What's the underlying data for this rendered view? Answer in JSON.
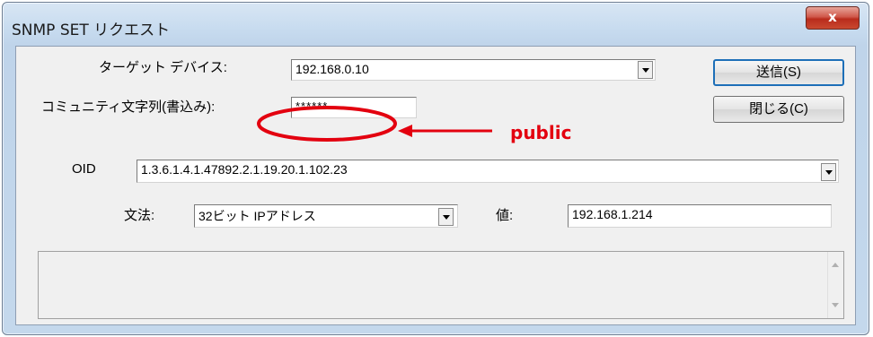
{
  "window": {
    "title": "SNMP SET リクエスト",
    "close_glyph": "x"
  },
  "target": {
    "label": "ターゲット デバイス:",
    "value": "192.168.0.10"
  },
  "community": {
    "label": "コミュニティ文字列(書込み):",
    "value": "******"
  },
  "buttons": {
    "send": "送信(S)",
    "close": "閉じる(C)"
  },
  "oid": {
    "label": "OID",
    "value": "1.3.6.1.4.1.47892.2.1.19.20.1.102.23"
  },
  "syntax": {
    "label": "文法:",
    "value": "32ビット IPアドレス"
  },
  "val": {
    "label": "値:",
    "value": "192.168.1.214"
  },
  "annotation": {
    "text": "public",
    "color": "#e3000f"
  }
}
